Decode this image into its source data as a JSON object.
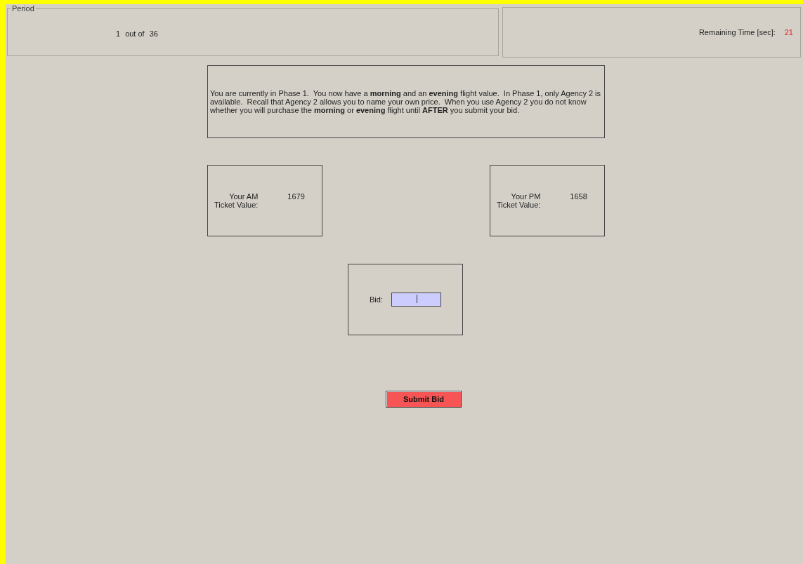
{
  "period": {
    "legend": "Period",
    "current": "1",
    "separator": "out of",
    "total": "36"
  },
  "timer": {
    "label": "Remaining Time [sec]:",
    "value": "21"
  },
  "message": "You are currently in Phase 1.  You now have a **morning** and an **evening** flight value.  In Phase 1, only Agency 2 is available.  Recall that Agency 2 allows you to name your own price.  When you use Agency 2 you do not know whether you will purchase the **morning** or **evening** flight until **AFTER** you submit your bid.",
  "values": [
    {
      "label_line1": "Your AM",
      "label_line2": "Ticket Value:",
      "value": "1679"
    },
    {
      "label_line1": "Your PM",
      "label_line2": "Ticket Value:",
      "value": "1658"
    }
  ],
  "bid": {
    "label": "Bid:"
  },
  "submit_button": "Submit Bid"
}
